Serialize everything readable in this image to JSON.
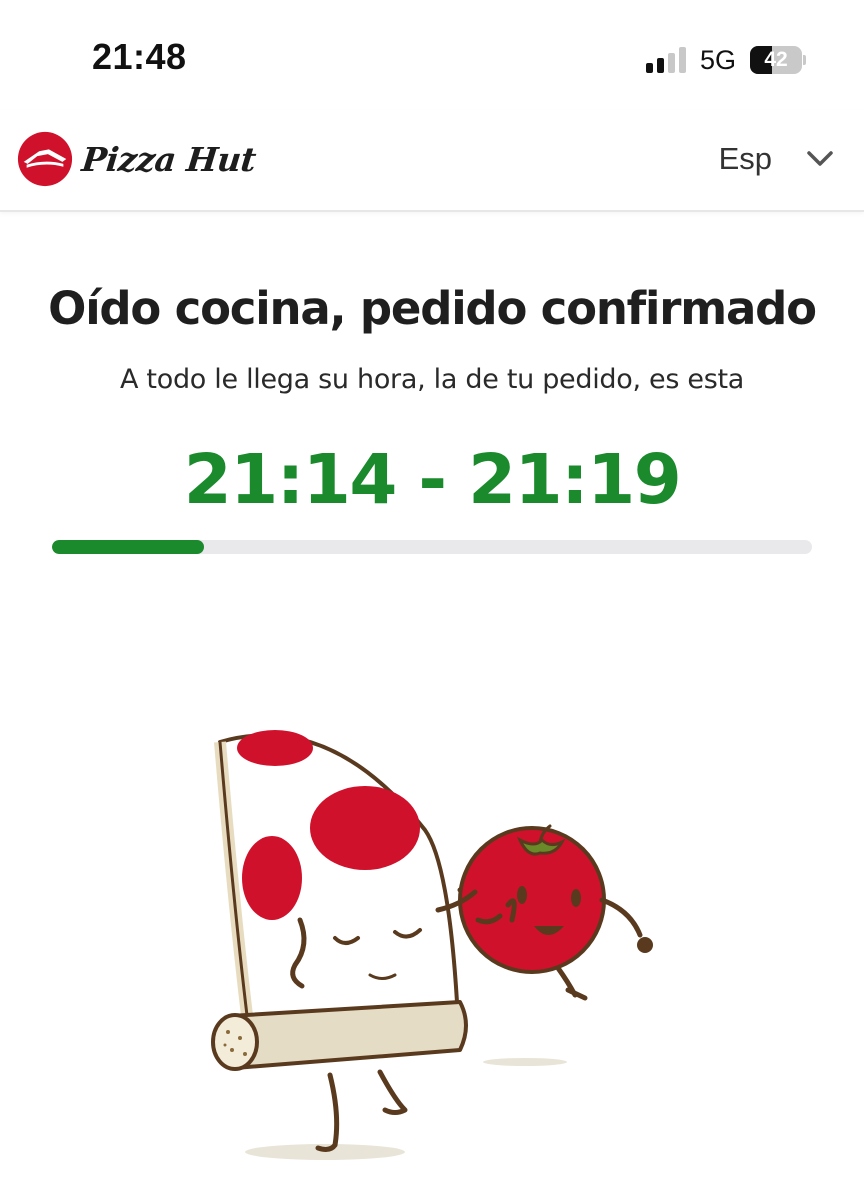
{
  "status_bar": {
    "time": "21:48",
    "network": "5G",
    "battery_level": "42",
    "signal_bars_active": 2,
    "signal_bars_total": 4
  },
  "header": {
    "brand_name": "Pizza Hut",
    "logo_icon": "pizza-hut-roof-logo",
    "language": {
      "selected": "Esp",
      "icon": "chevron-down-icon"
    }
  },
  "order": {
    "headline": "Oído cocina, pedido confirmado",
    "subline": "A todo le llega su hora, la de tu pedido, es esta",
    "time_window": "21:14 - 21:19",
    "progress": 0.2
  },
  "illustration": {
    "subject": "pizza-slice-and-tomato-dancing"
  },
  "colors": {
    "accent_green": "#1b8a2c",
    "brand_red": "#d0112b",
    "progress_track": "#e9e9eb",
    "text_dark": "#1f1f1f"
  }
}
